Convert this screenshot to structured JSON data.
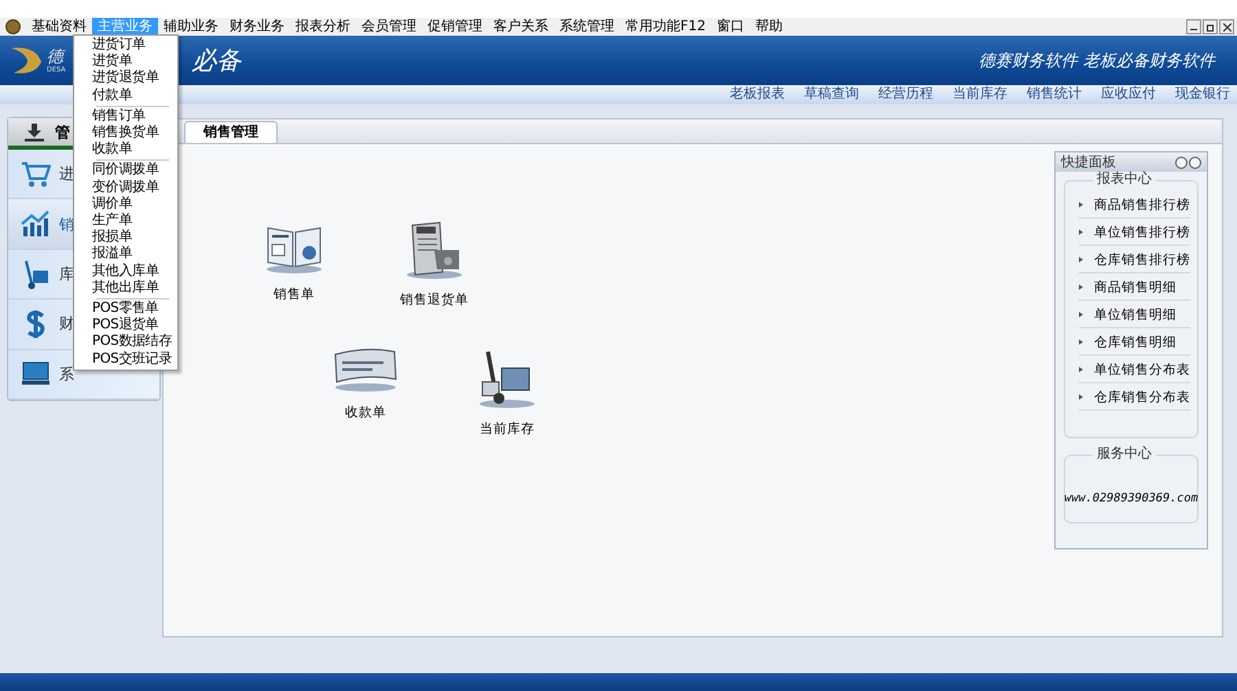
{
  "menu_bar": {
    "items": [
      {
        "label": "基础资料",
        "selected": false
      },
      {
        "label": "主营业务",
        "selected": true
      },
      {
        "label": "辅助业务",
        "selected": false
      },
      {
        "label": "财务业务",
        "selected": false
      },
      {
        "label": "报表分析",
        "selected": false
      },
      {
        "label": "会员管理",
        "selected": false
      },
      {
        "label": "促销管理",
        "selected": false
      },
      {
        "label": "客户关系",
        "selected": false
      },
      {
        "label": "系统管理",
        "selected": false
      },
      {
        "label": "常用功能F12",
        "selected": false
      },
      {
        "label": "窗口",
        "selected": false
      },
      {
        "label": "帮助",
        "selected": false
      }
    ]
  },
  "dropdown": {
    "groups": [
      [
        "进货订单",
        "进货单",
        "进货退货单",
        "付款单"
      ],
      [
        "销售订单",
        "销售换货单",
        "收款单"
      ],
      [
        "同价调拨单",
        "变价调拨单",
        "调价单",
        "生产单",
        "报损单",
        "报溢单",
        "其他入库单",
        "其他出库单"
      ],
      [
        "POS零售单",
        "POS退货单",
        "POS数据结存",
        "POS交班记录"
      ]
    ]
  },
  "banner": {
    "logo_text": "德",
    "logo_subtext": "DESA",
    "title": "必备",
    "slogan": "德赛财务软件 老板必备财务软件"
  },
  "quick_links": [
    "老板报表",
    "草稿查询",
    "经营历程",
    "当前库存",
    "销售统计",
    "应收应付",
    "现金银行"
  ],
  "sidebar": {
    "header": "管",
    "items": [
      {
        "label": "进",
        "selected": false
      },
      {
        "label": "销",
        "selected": true
      },
      {
        "label": "库",
        "selected": false
      },
      {
        "label": "财",
        "selected": false
      },
      {
        "label": "系",
        "selected": false
      }
    ]
  },
  "tabs": [
    {
      "label": "销售管理",
      "selected": true
    }
  ],
  "canvas_items": [
    {
      "label": "销售单"
    },
    {
      "label": "销售退货单"
    },
    {
      "label": "收款单"
    },
    {
      "label": "当前库存"
    }
  ],
  "quick_panel": {
    "title": "快捷面板",
    "report_center": {
      "title": "报表中心",
      "items": [
        "商品销售排行榜",
        "单位销售排行榜",
        "仓库销售排行榜",
        "商品销售明细",
        "单位销售明细",
        "仓库销售明细",
        "单位销售分布表",
        "仓库销售分布表"
      ]
    },
    "service_center": {
      "title": "服务中心",
      "text": "www.02989390369.com"
    }
  }
}
